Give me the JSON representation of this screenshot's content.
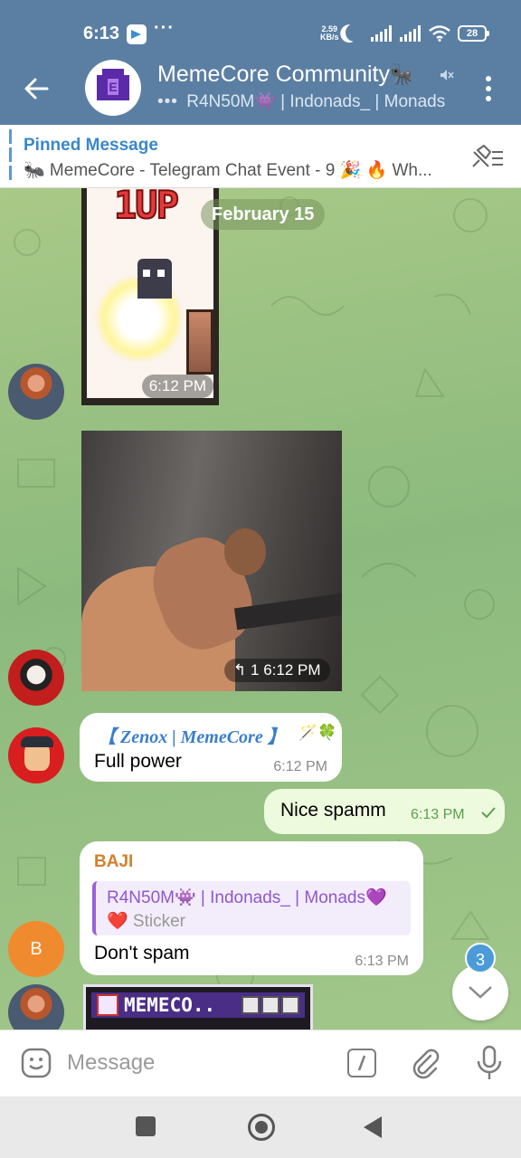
{
  "status_bar": {
    "time": "6:13",
    "more": "···",
    "net_speed_value": "2.59",
    "net_speed_unit": "KB/s",
    "battery": "28"
  },
  "header": {
    "title": "MemeCore Community🐜",
    "subtitle_typing": "•••",
    "subtitle": "R4N50M👾 | Indonads_ | Monads"
  },
  "pinned": {
    "label": "Pinned Message",
    "text": "🐜 MemeCore - Telegram Chat Event - 9 🎉 🔥 Wh..."
  },
  "chat": {
    "date": "February 15",
    "messages": [
      {
        "type": "sticker",
        "sticker_text": "1UP",
        "time": "6:12 PM"
      },
      {
        "type": "video",
        "replies": "1",
        "time": "6:12 PM"
      },
      {
        "type": "text",
        "sender": "【 Zenox | MemeCore 】",
        "badge": "🪄🍀",
        "text": "Full power",
        "time": "6:12 PM"
      },
      {
        "type": "outgoing",
        "text": "Nice spamm",
        "time": "6:13 PM"
      },
      {
        "type": "reply",
        "sender": "BAJI",
        "reply_to": "R4N50M👾 | Indonads_ | Monads💜",
        "reply_text": "❤️ Sticker",
        "text": "Don't spam",
        "time": "6:13 PM"
      },
      {
        "type": "sticker",
        "sticker_text": "MEMECO.."
      }
    ],
    "avatar_initial": "B",
    "unread_count": "3"
  },
  "input": {
    "placeholder": "Message"
  },
  "colors": {
    "header_bg": "#5b7fa3",
    "accent": "#3a88c8",
    "outgoing_bubble": "#eefadd",
    "unread_badge": "#4c9bd9"
  }
}
